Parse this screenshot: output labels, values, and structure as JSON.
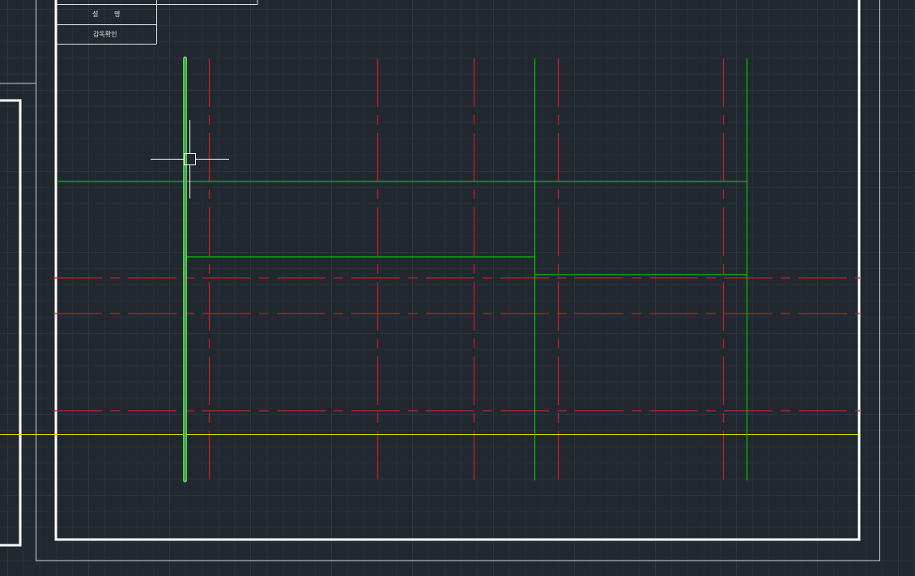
{
  "title_block": {
    "rows": [
      {
        "left": "설",
        "right": "명"
      },
      {
        "label": "감독확인"
      }
    ]
  },
  "colors": {
    "background": "#212830",
    "grid_minor": "#262e38",
    "grid_major": "#2c3540",
    "frame": "#ffffff",
    "wall_green": "#00c800",
    "axis_red": "#c81e1e",
    "axis_yellow": "#e6e600",
    "selected_glow": "#7bd77b"
  }
}
